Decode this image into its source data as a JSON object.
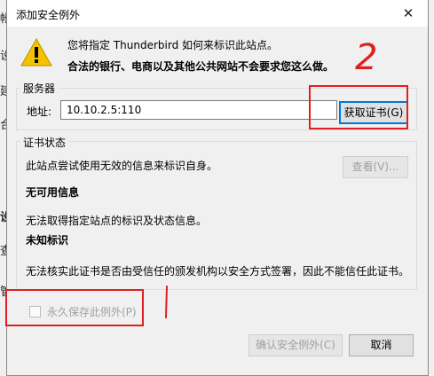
{
  "dialog": {
    "title": "添加安全例外",
    "warning_line1": "您将指定 Thunderbird 如何来标识此站点。",
    "warning_line2": "合法的银行、电商以及其他公共网站不会要求您这么做。"
  },
  "server": {
    "group_label": "服务器",
    "address_label": "地址:",
    "address_value": "10.10.2.5:110",
    "get_cert_button": "获取证书(G)"
  },
  "cert_status": {
    "group_label": "证书状态",
    "status_text": "此站点尝试使用无效的信息来标识自身。",
    "view_button": "查看(V)...",
    "heading1": "无可用信息",
    "text1": "无法取得指定站点的标识及状态信息。",
    "heading2": "未知标识",
    "text2": "无法核实此证书是否由受信任的颁发机构以安全方式签署，因此不能信任此证书。"
  },
  "permanent_checkbox": {
    "label": "永久保存此例外(P)",
    "checked": false
  },
  "footer": {
    "confirm_button": "确认安全例外(C)",
    "cancel_button": "取消"
  },
  "background_chars": [
    "帐",
    "设",
    "建",
    "合",
    "设",
    "查",
    "管"
  ],
  "annotation": {
    "number": "2",
    "color": "#e02020"
  }
}
